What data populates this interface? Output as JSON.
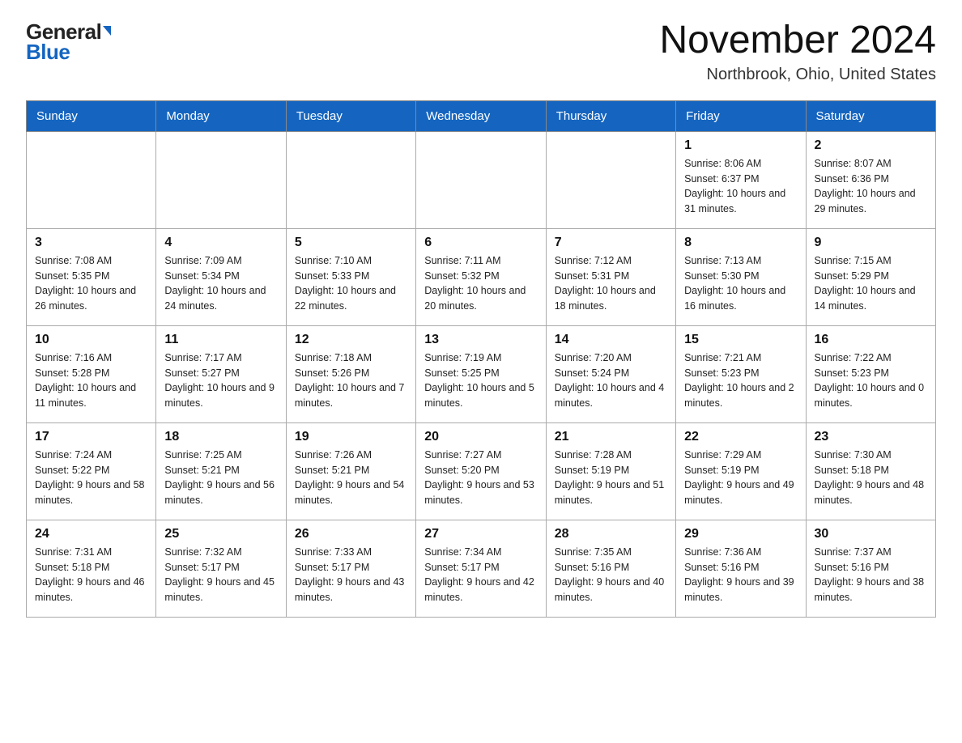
{
  "logo": {
    "general": "General",
    "blue": "Blue"
  },
  "title": "November 2024",
  "subtitle": "Northbrook, Ohio, United States",
  "days_of_week": [
    "Sunday",
    "Monday",
    "Tuesday",
    "Wednesday",
    "Thursday",
    "Friday",
    "Saturday"
  ],
  "weeks": [
    [
      {
        "day": "",
        "info": ""
      },
      {
        "day": "",
        "info": ""
      },
      {
        "day": "",
        "info": ""
      },
      {
        "day": "",
        "info": ""
      },
      {
        "day": "",
        "info": ""
      },
      {
        "day": "1",
        "info": "Sunrise: 8:06 AM\nSunset: 6:37 PM\nDaylight: 10 hours and 31 minutes."
      },
      {
        "day": "2",
        "info": "Sunrise: 8:07 AM\nSunset: 6:36 PM\nDaylight: 10 hours and 29 minutes."
      }
    ],
    [
      {
        "day": "3",
        "info": "Sunrise: 7:08 AM\nSunset: 5:35 PM\nDaylight: 10 hours and 26 minutes."
      },
      {
        "day": "4",
        "info": "Sunrise: 7:09 AM\nSunset: 5:34 PM\nDaylight: 10 hours and 24 minutes."
      },
      {
        "day": "5",
        "info": "Sunrise: 7:10 AM\nSunset: 5:33 PM\nDaylight: 10 hours and 22 minutes."
      },
      {
        "day": "6",
        "info": "Sunrise: 7:11 AM\nSunset: 5:32 PM\nDaylight: 10 hours and 20 minutes."
      },
      {
        "day": "7",
        "info": "Sunrise: 7:12 AM\nSunset: 5:31 PM\nDaylight: 10 hours and 18 minutes."
      },
      {
        "day": "8",
        "info": "Sunrise: 7:13 AM\nSunset: 5:30 PM\nDaylight: 10 hours and 16 minutes."
      },
      {
        "day": "9",
        "info": "Sunrise: 7:15 AM\nSunset: 5:29 PM\nDaylight: 10 hours and 14 minutes."
      }
    ],
    [
      {
        "day": "10",
        "info": "Sunrise: 7:16 AM\nSunset: 5:28 PM\nDaylight: 10 hours and 11 minutes."
      },
      {
        "day": "11",
        "info": "Sunrise: 7:17 AM\nSunset: 5:27 PM\nDaylight: 10 hours and 9 minutes."
      },
      {
        "day": "12",
        "info": "Sunrise: 7:18 AM\nSunset: 5:26 PM\nDaylight: 10 hours and 7 minutes."
      },
      {
        "day": "13",
        "info": "Sunrise: 7:19 AM\nSunset: 5:25 PM\nDaylight: 10 hours and 5 minutes."
      },
      {
        "day": "14",
        "info": "Sunrise: 7:20 AM\nSunset: 5:24 PM\nDaylight: 10 hours and 4 minutes."
      },
      {
        "day": "15",
        "info": "Sunrise: 7:21 AM\nSunset: 5:23 PM\nDaylight: 10 hours and 2 minutes."
      },
      {
        "day": "16",
        "info": "Sunrise: 7:22 AM\nSunset: 5:23 PM\nDaylight: 10 hours and 0 minutes."
      }
    ],
    [
      {
        "day": "17",
        "info": "Sunrise: 7:24 AM\nSunset: 5:22 PM\nDaylight: 9 hours and 58 minutes."
      },
      {
        "day": "18",
        "info": "Sunrise: 7:25 AM\nSunset: 5:21 PM\nDaylight: 9 hours and 56 minutes."
      },
      {
        "day": "19",
        "info": "Sunrise: 7:26 AM\nSunset: 5:21 PM\nDaylight: 9 hours and 54 minutes."
      },
      {
        "day": "20",
        "info": "Sunrise: 7:27 AM\nSunset: 5:20 PM\nDaylight: 9 hours and 53 minutes."
      },
      {
        "day": "21",
        "info": "Sunrise: 7:28 AM\nSunset: 5:19 PM\nDaylight: 9 hours and 51 minutes."
      },
      {
        "day": "22",
        "info": "Sunrise: 7:29 AM\nSunset: 5:19 PM\nDaylight: 9 hours and 49 minutes."
      },
      {
        "day": "23",
        "info": "Sunrise: 7:30 AM\nSunset: 5:18 PM\nDaylight: 9 hours and 48 minutes."
      }
    ],
    [
      {
        "day": "24",
        "info": "Sunrise: 7:31 AM\nSunset: 5:18 PM\nDaylight: 9 hours and 46 minutes."
      },
      {
        "day": "25",
        "info": "Sunrise: 7:32 AM\nSunset: 5:17 PM\nDaylight: 9 hours and 45 minutes."
      },
      {
        "day": "26",
        "info": "Sunrise: 7:33 AM\nSunset: 5:17 PM\nDaylight: 9 hours and 43 minutes."
      },
      {
        "day": "27",
        "info": "Sunrise: 7:34 AM\nSunset: 5:17 PM\nDaylight: 9 hours and 42 minutes."
      },
      {
        "day": "28",
        "info": "Sunrise: 7:35 AM\nSunset: 5:16 PM\nDaylight: 9 hours and 40 minutes."
      },
      {
        "day": "29",
        "info": "Sunrise: 7:36 AM\nSunset: 5:16 PM\nDaylight: 9 hours and 39 minutes."
      },
      {
        "day": "30",
        "info": "Sunrise: 7:37 AM\nSunset: 5:16 PM\nDaylight: 9 hours and 38 minutes."
      }
    ]
  ]
}
